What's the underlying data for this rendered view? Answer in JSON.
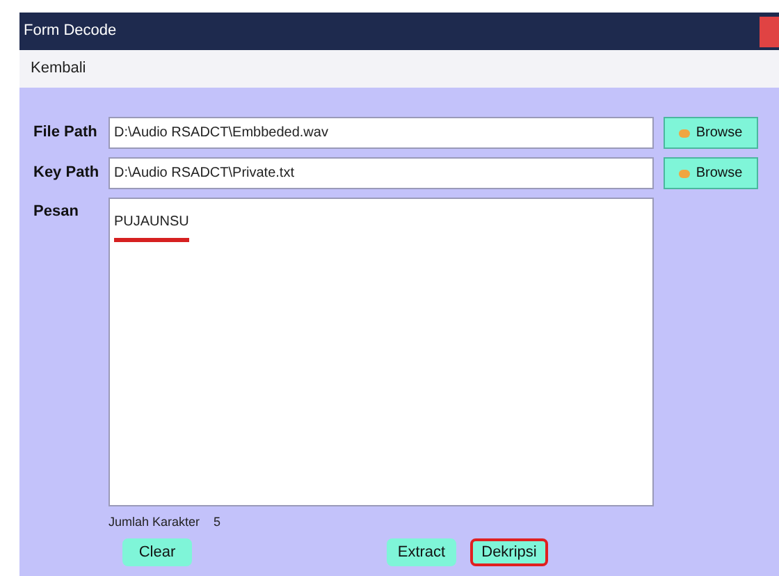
{
  "window": {
    "title": "Form Decode"
  },
  "menu": [
    "Kembali"
  ],
  "fields": [
    {
      "label": "File Path",
      "value": "D:\\Audio RSADCT\\Embbeded.wav",
      "button": "Browse"
    },
    {
      "label": "Key Path",
      "value": "D:\\Audio RSADCT\\Private.txt",
      "button": "Browse"
    }
  ],
  "message": {
    "label": "Pesan",
    "value": "PUJAUNSU",
    "underlined": true
  },
  "count": {
    "label": "Jumlah Karakter",
    "value": "5"
  },
  "buttons": [
    {
      "label": "Clear",
      "highlighted": false
    },
    {
      "label": "Extract",
      "highlighted": false
    },
    {
      "label": "Dekripsi",
      "highlighted": true
    }
  ]
}
